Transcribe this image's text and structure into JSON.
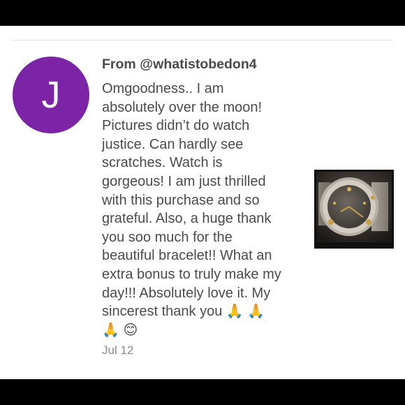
{
  "review": {
    "avatar_letter": "J",
    "from": "From @whatistobedon4",
    "message_lines": [
      "Omgoodness.. I am",
      "absolutely over the moon!",
      "Pictures didn’t do watch",
      "justice. Can hardly see",
      "scratches. Watch is",
      "gorgeous! I am just thrilled",
      "with this purchase and so",
      "grateful. Also, a huge thank",
      "you soo much for the",
      "beautiful bracelet!! What an",
      "extra bonus to truly make my",
      "day!!! Absolutely love it. My",
      "sincerest thank you 🙏 🙏",
      "🙏 😊"
    ],
    "date": "Jul 12",
    "photo_icon": "watch-photo"
  },
  "colors": {
    "avatar": "#7b25a6",
    "background": "#000000",
    "card": "#ffffff",
    "text": "#4b4b4b",
    "muted": "#8a8a8a"
  }
}
